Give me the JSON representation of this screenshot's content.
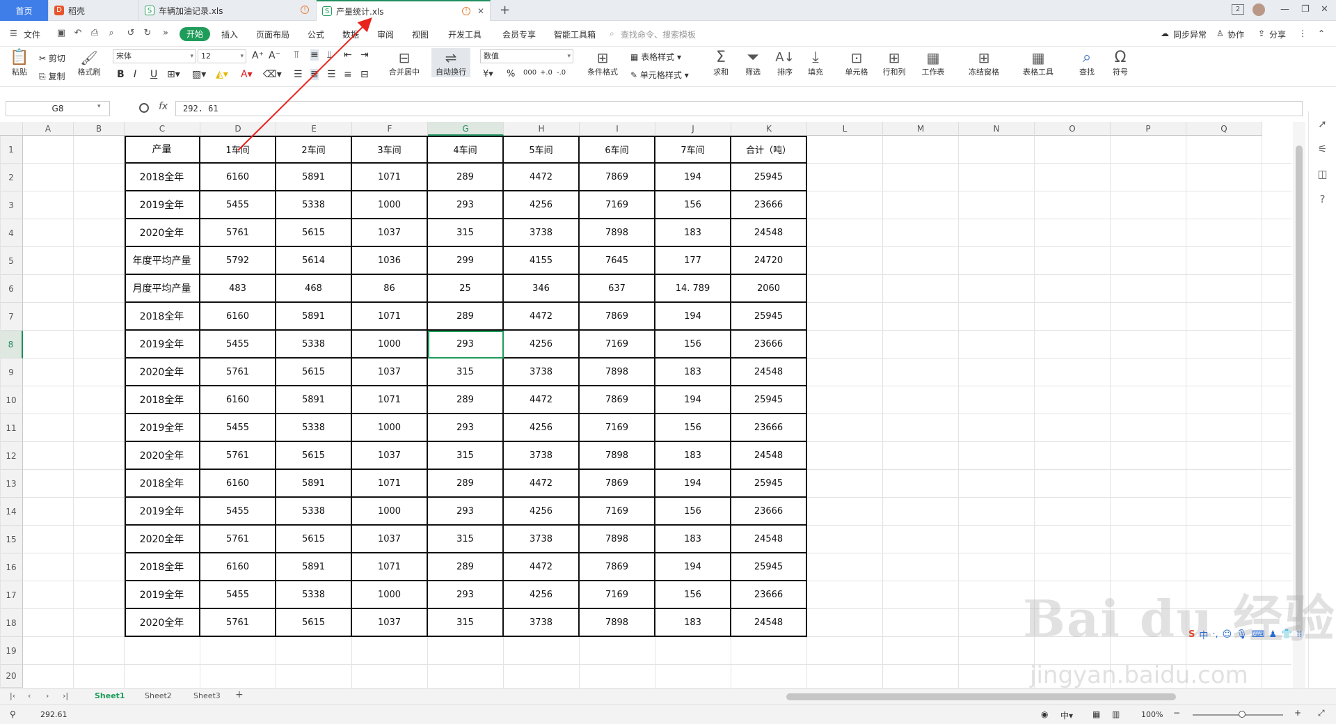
{
  "tabs": {
    "home": "首页",
    "t1": "稻壳",
    "t2": "车辆加油记录.xls",
    "t3": "产量统计.xls"
  },
  "window": {
    "badge": "2"
  },
  "menu": {
    "file": "文件",
    "start": "开始",
    "items": [
      "插入",
      "页面布局",
      "公式",
      "数据",
      "审阅",
      "视图",
      "开发工具",
      "会员专享",
      "智能工具箱"
    ],
    "search_placeholder": "查找命令、搜索模板",
    "sync": "同步异常",
    "collab": "协作",
    "share": "分享"
  },
  "ribbon": {
    "paste": "粘贴",
    "cut": "剪切",
    "copy": "复制",
    "format_painter": "格式刷",
    "font": "宋体",
    "size": "12",
    "merge": "合并居中",
    "wrap": "自动换行",
    "numfmt": "数值",
    "table_style": "表格样式",
    "cond_format": "条件格式",
    "cell_style": "单元格样式",
    "sum": "求和",
    "filter": "筛选",
    "sort": "排序",
    "fill": "填充",
    "cell": "单元格",
    "rowcol": "行和列",
    "sheet": "工作表",
    "freeze": "冻结窗格",
    "tools": "表格工具",
    "find": "查找",
    "symbol": "符号"
  },
  "formula_bar": {
    "name_box": "G8",
    "fx": "fx",
    "value": "292. 61"
  },
  "columns": [
    "A",
    "B",
    "C",
    "D",
    "E",
    "F",
    "G",
    "H",
    "I",
    "J",
    "K",
    "L",
    "M",
    "N",
    "O",
    "P",
    "Q"
  ],
  "rows": [
    "1",
    "2",
    "3",
    "4",
    "5",
    "6",
    "7",
    "8",
    "9",
    "10",
    "11",
    "12",
    "13",
    "14",
    "15",
    "16",
    "17",
    "18",
    "19",
    "20"
  ],
  "table": {
    "header": [
      "产量",
      "1车间",
      "2车间",
      "3车间",
      "4车间",
      "5车间",
      "6车间",
      "7车间",
      "合计（吨）"
    ],
    "rows": [
      [
        "2018全年",
        "6160",
        "5891",
        "1071",
        "289",
        "4472",
        "7869",
        "194",
        "25945"
      ],
      [
        "2019全年",
        "5455",
        "5338",
        "1000",
        "293",
        "4256",
        "7169",
        "156",
        "23666"
      ],
      [
        "2020全年",
        "5761",
        "5615",
        "1037",
        "315",
        "3738",
        "7898",
        "183",
        "24548"
      ],
      [
        "年度平均产量",
        "5792",
        "5614",
        "1036",
        "299",
        "4155",
        "7645",
        "177",
        "24720"
      ],
      [
        "月度平均产量",
        "483",
        "468",
        "86",
        "25",
        "346",
        "637",
        "14. 789",
        "2060"
      ],
      [
        "2018全年",
        "6160",
        "5891",
        "1071",
        "289",
        "4472",
        "7869",
        "194",
        "25945"
      ],
      [
        "2019全年",
        "5455",
        "5338",
        "1000",
        "293",
        "4256",
        "7169",
        "156",
        "23666"
      ],
      [
        "2020全年",
        "5761",
        "5615",
        "1037",
        "315",
        "3738",
        "7898",
        "183",
        "24548"
      ],
      [
        "2018全年",
        "6160",
        "5891",
        "1071",
        "289",
        "4472",
        "7869",
        "194",
        "25945"
      ],
      [
        "2019全年",
        "5455",
        "5338",
        "1000",
        "293",
        "4256",
        "7169",
        "156",
        "23666"
      ],
      [
        "2020全年",
        "5761",
        "5615",
        "1037",
        "315",
        "3738",
        "7898",
        "183",
        "24548"
      ],
      [
        "2018全年",
        "6160",
        "5891",
        "1071",
        "289",
        "4472",
        "7869",
        "194",
        "25945"
      ],
      [
        "2019全年",
        "5455",
        "5338",
        "1000",
        "293",
        "4256",
        "7169",
        "156",
        "23666"
      ],
      [
        "2020全年",
        "5761",
        "5615",
        "1037",
        "315",
        "3738",
        "7898",
        "183",
        "24548"
      ],
      [
        "2018全年",
        "6160",
        "5891",
        "1071",
        "289",
        "4472",
        "7869",
        "194",
        "25945"
      ],
      [
        "2019全年",
        "5455",
        "5338",
        "1000",
        "293",
        "4256",
        "7169",
        "156",
        "23666"
      ],
      [
        "2020全年",
        "5761",
        "5615",
        "1037",
        "315",
        "3738",
        "7898",
        "183",
        "24548"
      ]
    ]
  },
  "sheets": [
    "Sheet1",
    "Sheet2",
    "Sheet3"
  ],
  "status": {
    "value": "292.61",
    "zoom": "100%"
  },
  "watermark": {
    "main": "Bai du 经验",
    "sub": "jingyan.baidu.com"
  },
  "colors": {
    "accent": "#1f9c5a",
    "home_tab": "#3f7ee8",
    "arrow": "#e8231d"
  }
}
